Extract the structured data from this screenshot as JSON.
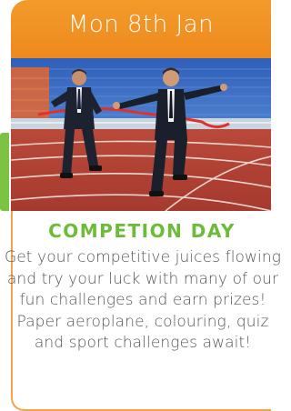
{
  "header": {
    "date": "Mon 8th Jan"
  },
  "photo": {
    "alt_icon": "two-businessmen-running-finish-line"
  },
  "event": {
    "title": "COMPETION DAY",
    "description": "Get your competitive juices flowing and try your luck with many of our fun challenges and earn prizes! Paper aeroplane, colouring, quiz and sport challenges await!"
  },
  "colors": {
    "header_orange": "#ee8a1d",
    "title_green": "#6cbc3a",
    "accent_green": "#7cc243",
    "body_text": "#555555",
    "border_orange": "#f2a34b"
  }
}
